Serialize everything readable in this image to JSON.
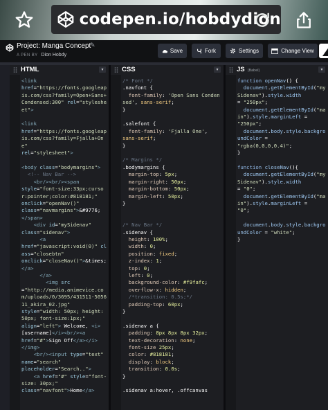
{
  "browser": {
    "url": "codepen.io/hobdydion",
    "icons": [
      "star-icon",
      "codepen-logo-icon",
      "reload-icon",
      "share-icon"
    ]
  },
  "header": {
    "project_title": "Project: Manga Concept",
    "byline_prefix": "A PEN BY",
    "author": "Dion Hobdy",
    "buttons": {
      "save": "Save",
      "fork": "Fork",
      "settings": "Settings",
      "change_view": "Change View"
    }
  },
  "panels": {
    "html": {
      "title": "HTML"
    },
    "css": {
      "title": "CSS"
    },
    "js": {
      "title": "JS",
      "subtitle": "(Babel)"
    }
  },
  "colors": {
    "background": "#1e1f26",
    "header_bg": "#111214",
    "button_bg": "#2c303a"
  }
}
